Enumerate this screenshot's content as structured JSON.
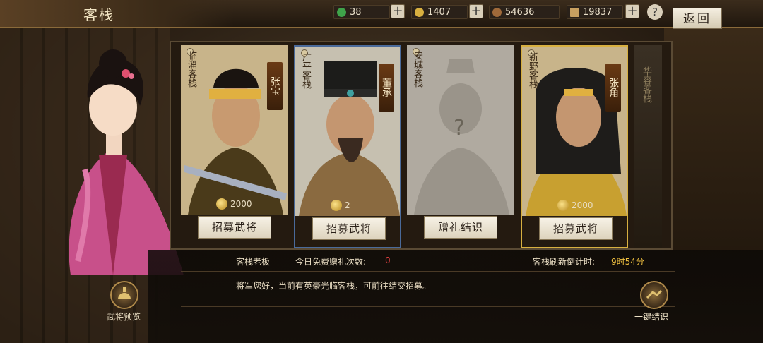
{
  "header": {
    "title": "客栈",
    "back_label": "返回",
    "help_label": "?"
  },
  "resources": [
    {
      "icon": "jade-icon",
      "value": "38",
      "color": "#3fa34a"
    },
    {
      "icon": "gold-coin-icon",
      "value": "1407",
      "color": "#d8b040"
    },
    {
      "icon": "copper-coin-icon",
      "value": "54636",
      "color": "#a06a3a"
    },
    {
      "icon": "grain-icon",
      "value": "19837",
      "color": "#c8a060"
    }
  ],
  "cards": [
    {
      "location": "临淄客栈",
      "hero": "张宝",
      "cost": "2000",
      "button": "招募武将",
      "bg": "#c8b48a",
      "tint": "#b09460"
    },
    {
      "location": "广平客栈",
      "hero": "董承",
      "cost": "2",
      "button": "招募武将",
      "bg": "#c6c0b0",
      "tint": "#8aa0b8"
    },
    {
      "location": "安城客栈",
      "hero": "",
      "cost": "",
      "button": "赠礼结识",
      "bg": "#b0aaa0",
      "tint": "#9a948a"
    },
    {
      "location": "新野客栈",
      "hero": "张角",
      "cost": "2000",
      "button": "招募武将",
      "bg": "#c8b48a",
      "tint": "#b09460"
    }
  ],
  "unknown_mark": "?",
  "side_card": {
    "location": "华容客栈"
  },
  "info": {
    "speaker": "客栈老板",
    "free_gift_label": "今日免费赠礼次数:",
    "free_gift_count": "0",
    "refresh_label": "客栈刷新倒计时:",
    "refresh_time": "9时54分",
    "message": "将军您好，当前有英豪光临客栈，可前往结交招募。"
  },
  "bottom_buttons": {
    "preview": "武将预览",
    "one_click": "一键结识"
  }
}
